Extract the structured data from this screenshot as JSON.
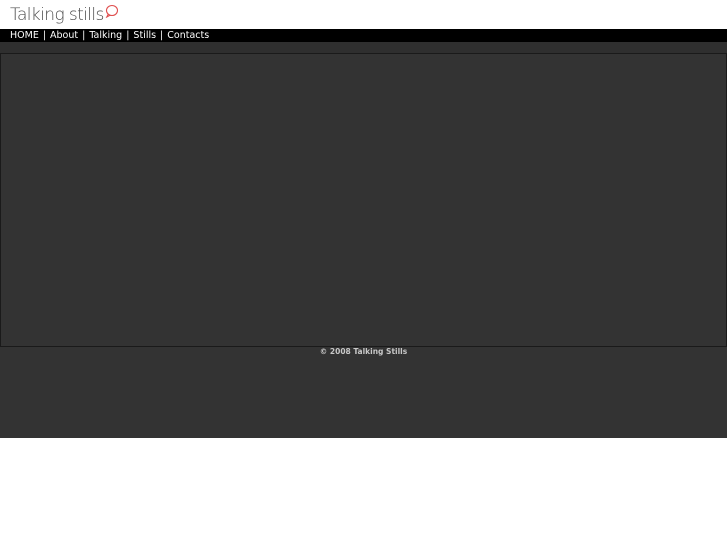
{
  "logo": {
    "text": "Talking stills",
    "icon": "speech-bubble-icon",
    "bubble_color": "#e05050"
  },
  "nav": {
    "items": [
      {
        "label": "HOME"
      },
      {
        "label": "About"
      },
      {
        "label": "Talking"
      },
      {
        "label": "Stills"
      },
      {
        "label": "Contacts"
      }
    ],
    "separator": "|"
  },
  "footer": {
    "copyright": "© 2008 Talking Stills"
  },
  "colors": {
    "page_background": "#ffffff",
    "nav_background": "#000000",
    "content_background": "#333333",
    "text_light": "#ffffff"
  }
}
